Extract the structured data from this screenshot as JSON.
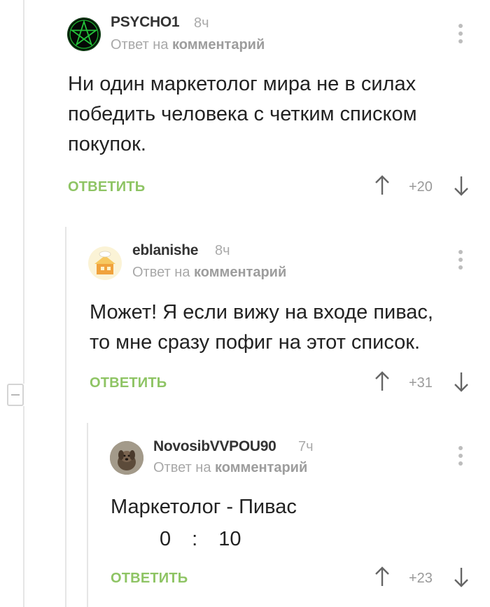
{
  "comments": [
    {
      "author": "PSYCHO1",
      "time": "8ч",
      "reply_prefix": "Ответ на",
      "reply_link": "комментарий",
      "lines": [
        "Ни один маркетолог мира не в силах",
        "победить человека с четким списком",
        "покупок."
      ],
      "reply_label": "ОТВЕТИТЬ",
      "rating": "+20",
      "avatar_icon": "green-pentagram"
    },
    {
      "author": "eblanishe",
      "time": "8ч",
      "reply_prefix": "Ответ на",
      "reply_link": "комментарий",
      "lines": [
        "Может! Я если вижу на входе пивас,",
        "то мне сразу пофиг на этот список."
      ],
      "reply_label": "ОТВЕТИТЬ",
      "rating": "+31",
      "avatar_icon": "cartoon-house"
    },
    {
      "author": "NovosibVVPOU90",
      "time": "7ч",
      "reply_prefix": "Ответ на",
      "reply_link": "комментарий",
      "lines": [
        "Маркетолог - Пивас"
      ],
      "score": {
        "left": "0",
        "sep": ":",
        "right": "10"
      },
      "reply_label": "ОТВЕТИТЬ",
      "rating": "+23",
      "avatar_icon": "dog-photo"
    }
  ],
  "colors": {
    "accent": "#8ec464",
    "text": "#222222",
    "muted": "#aaaaaa"
  }
}
